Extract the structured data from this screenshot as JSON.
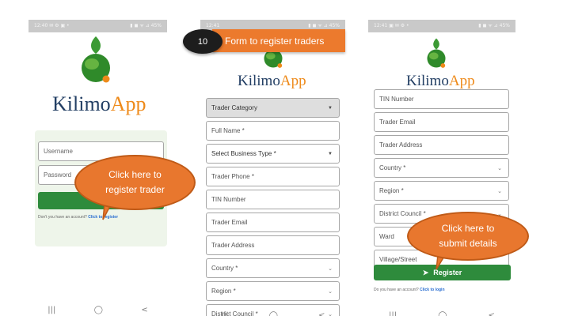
{
  "screens": {
    "login": {
      "status_time": "12:40",
      "status_icons": "✉ ⚙ ▣ •",
      "status_right": "▮ ◼ ᯤ ⊿ 45%",
      "logo_kilimo": "Kilimo",
      "logo_app": "App",
      "username_placeholder": "Username",
      "password_placeholder": "Password",
      "no_account_text": "Don't you have an account?",
      "register_link": "Click to register",
      "nav": [
        "|||",
        "◯",
        "<"
      ]
    },
    "form": {
      "status_time": "12:41",
      "status_right": "▮ ◼ ᯤ ⊿ 45%",
      "logo_kilimo": "Kilimo",
      "logo_app": "App",
      "fields": [
        {
          "label": "Trader Category",
          "kind": "select"
        },
        {
          "label": "Full Name *",
          "kind": "text"
        },
        {
          "label": "Select Business Type *",
          "kind": "select"
        },
        {
          "label": "Trader Phone *",
          "kind": "text"
        },
        {
          "label": "TIN Number",
          "kind": "text"
        },
        {
          "label": "Trader Email",
          "kind": "text"
        },
        {
          "label": "Trader Address",
          "kind": "text"
        },
        {
          "label": "Country *",
          "kind": "dropdown"
        },
        {
          "label": "Region *",
          "kind": "dropdown"
        },
        {
          "label": "District Council *",
          "kind": "dropdown"
        }
      ],
      "nav": [
        "|||",
        "◯",
        "<"
      ]
    },
    "submit": {
      "status_time": "12:41",
      "status_icons": "▣ ✉ ⚙ •",
      "status_right": "▮ ◼ ᯤ ⊿ 45%",
      "logo_kilimo": "Kilimo",
      "logo_app": "App",
      "fields": [
        {
          "label": "TIN Number",
          "kind": "text"
        },
        {
          "label": "Trader Email",
          "kind": "text"
        },
        {
          "label": "Trader Address",
          "kind": "text"
        },
        {
          "label": "Country *",
          "kind": "dropdown"
        },
        {
          "label": "Region *",
          "kind": "dropdown"
        },
        {
          "label": "District Council *",
          "kind": "dropdown"
        },
        {
          "label": "Ward",
          "kind": "text"
        },
        {
          "label": "Village/Street",
          "kind": "text"
        }
      ],
      "register_button": "Register",
      "register_icon": "send-icon",
      "have_account_text": "Do you have an account?",
      "login_link": "Click to login",
      "nav": [
        "|||",
        "◯",
        "<"
      ]
    }
  },
  "callouts": {
    "register_trader": [
      "Click here to",
      "register trader"
    ],
    "submit_details": [
      "Click here to",
      "submit details"
    ],
    "step_number": "10",
    "step_title": "Form to register traders"
  },
  "colors": {
    "brand_green": "#2e8b3c",
    "logo_navy": "#233f64",
    "logo_orange": "#ee8a1a",
    "callout_orange": "#e8772e",
    "link_blue": "#2a6ed1"
  }
}
